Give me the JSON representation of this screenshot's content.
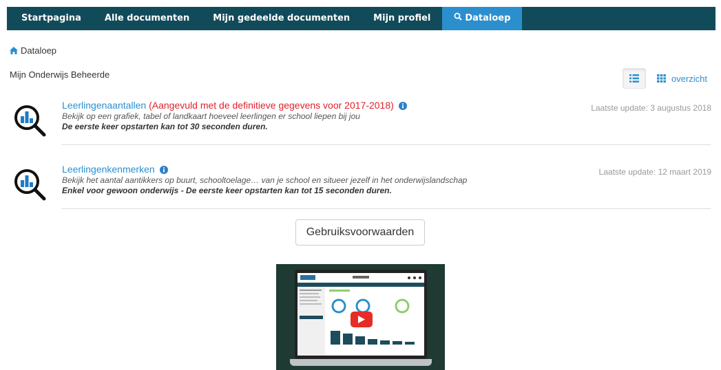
{
  "nav": {
    "items": [
      {
        "label": "Startpagina"
      },
      {
        "label": "Alle documenten"
      },
      {
        "label": "Mijn gedeelde documenten"
      },
      {
        "label": "Mijn profiel"
      },
      {
        "label": "Dataloep",
        "active": true
      }
    ]
  },
  "breadcrumb": {
    "label": "Dataloep"
  },
  "section": {
    "title": "Mijn Onderwijs Beheerde"
  },
  "view": {
    "overview_label": "overzicht"
  },
  "items": [
    {
      "title": "Leerlingenaantallen",
      "note": "(Aangevuld met de definitieve gegevens voor 2017-2018)",
      "description": "Bekijk op een grafiek, tabel of landkaart hoeveel leerlingen er school liepen bij jou",
      "warning": "De eerste keer opstarten kan tot 30 seconden duren.",
      "updated": "Laatste update: 3 augustus 2018"
    },
    {
      "title": "Leerlingenkenmerken",
      "note": "",
      "description": "Bekijk het aantal aantikkers op buurt, schooltoelage… van je school en situeer jezelf in het onderwijslandschap",
      "warning": "Enkel voor gewoon onderwijs - De eerste keer opstarten kan tot 15 seconden duren.",
      "updated": "Laatste update: 12 maart 2019"
    }
  ],
  "terms": {
    "label": "Gebruiksvoorwaarden"
  },
  "colors": {
    "nav_bg": "#114b5a",
    "nav_active": "#2b8fce",
    "link": "#2b8fce",
    "alert": "#e2202a"
  }
}
